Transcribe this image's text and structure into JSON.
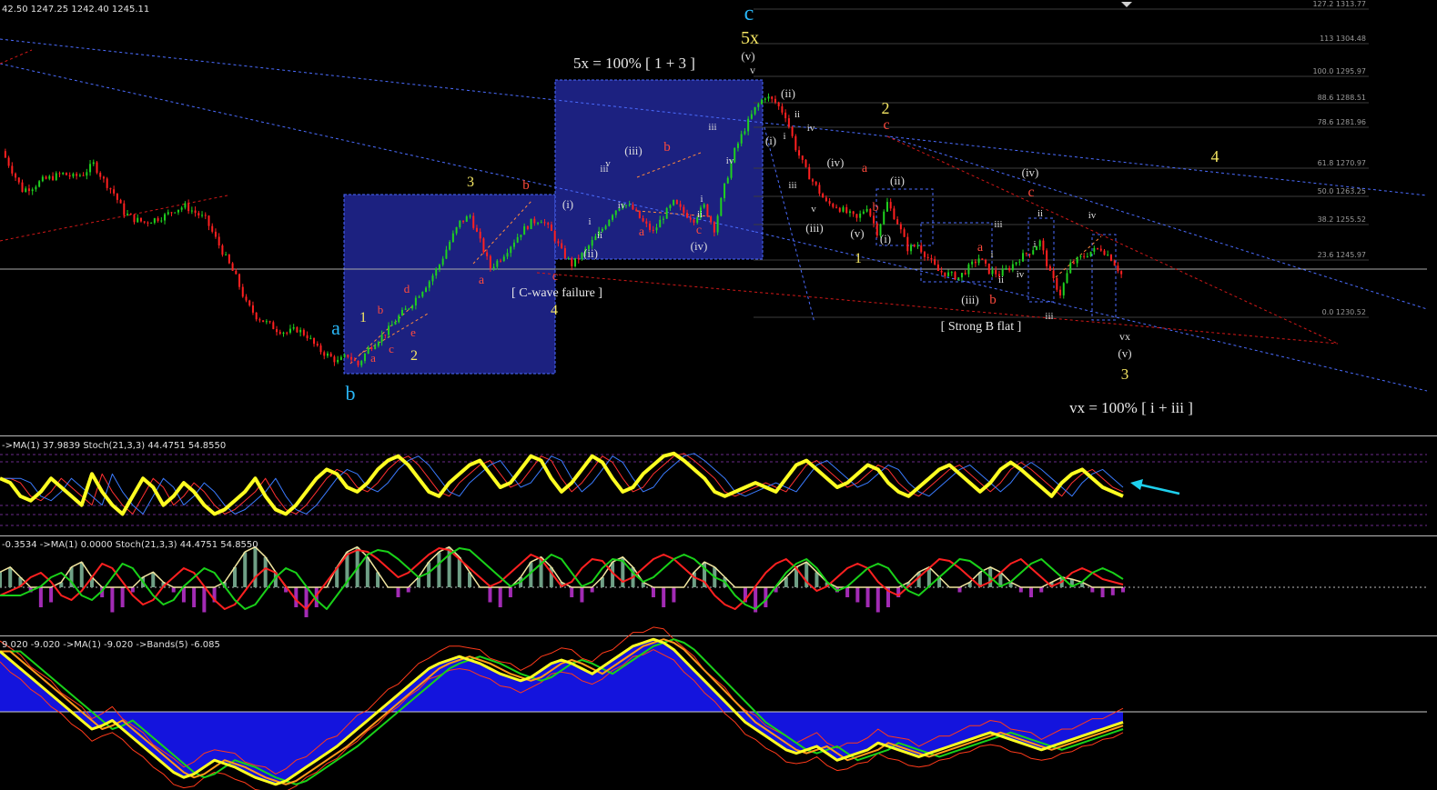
{
  "header": {
    "price_readout": "42.50 1247.25 1242.40 1245.11"
  },
  "panels": {
    "stoch1": {
      "label": "->MA(1) 37.9839  Stoch(21,3,3) 44.4751 54.8550"
    },
    "stoch2": {
      "label": "-0.3534  ->MA(1) 0.0000  Stoch(21,3,3) 44.4751 54.8550"
    },
    "bands": {
      "label": "9.020 -9.020  ->MA(1) -9.020  ->Bands(5) -6.085"
    }
  },
  "annotations": {
    "title_5x": "5x = 100% [ 1 + 3 ]",
    "c_wave_failure": "[ C-wave failure ]",
    "strong_b_flat": "[ Strong B flat ]",
    "vx_ratio": "vx = 100% [ i + iii ]"
  },
  "fib_levels": [
    {
      "label": "127.2 1313.77"
    },
    {
      "label": "113 1304.48"
    },
    {
      "label": "100.0 1295.97"
    },
    {
      "label": "88.6 1288.51"
    },
    {
      "label": "78.6 1281.96"
    },
    {
      "label": "61.8 1270.97"
    },
    {
      "label": "50.0 1263.25"
    },
    {
      "label": "38.2 1255.52"
    },
    {
      "label": "23.6 1245.97"
    },
    {
      "label": "0.0 1230.52"
    }
  ],
  "wave_labels": [
    {
      "text": "c",
      "color": "#29b6f6",
      "size": 24
    },
    {
      "text": "5x",
      "color": "#f5e663",
      "size": 20
    },
    {
      "text": "(v)",
      "color": "#dddddd",
      "size": 13
    },
    {
      "text": "v",
      "color": "#dddddd",
      "size": 12
    },
    {
      "text": "a",
      "color": "#29b6f6",
      "size": 22
    },
    {
      "text": "b",
      "color": "#29b6f6",
      "size": 22
    },
    {
      "text": "1",
      "color": "#f5e663",
      "size": 16
    },
    {
      "text": "2",
      "color": "#f5e663",
      "size": 16
    },
    {
      "text": "b",
      "color": "#ff4a3d",
      "size": 13
    },
    {
      "text": "d",
      "color": "#ff4a3d",
      "size": 13
    },
    {
      "text": "a",
      "color": "#ff4a3d",
      "size": 13
    },
    {
      "text": "c",
      "color": "#ff4a3d",
      "size": 13
    },
    {
      "text": "e",
      "color": "#ff4a3d",
      "size": 13
    },
    {
      "text": "3",
      "color": "#f5e663",
      "size": 16
    },
    {
      "text": "b",
      "color": "#ff4a3d",
      "size": 15
    },
    {
      "text": "a",
      "color": "#ff4a3d",
      "size": 14
    },
    {
      "text": "c",
      "color": "#ff4a3d",
      "size": 14
    },
    {
      "text": "4",
      "color": "#f5e663",
      "size": 16
    },
    {
      "text": "(i)",
      "color": "#dddddd",
      "size": 13
    },
    {
      "text": "(ii)",
      "color": "#dddddd",
      "size": 13
    },
    {
      "text": "ii",
      "color": "#dddddd",
      "size": 11
    },
    {
      "text": "i",
      "color": "#dddddd",
      "size": 11
    },
    {
      "text": "iii",
      "color": "#dddddd",
      "size": 11
    },
    {
      "text": "iv",
      "color": "#dddddd",
      "size": 11
    },
    {
      "text": "(iii)",
      "color": "#dddddd",
      "size": 13
    },
    {
      "text": "v",
      "color": "#dddddd",
      "size": 11
    },
    {
      "text": "b",
      "color": "#ff4a3d",
      "size": 15
    },
    {
      "text": "a",
      "color": "#ff4a3d",
      "size": 14
    },
    {
      "text": "c",
      "color": "#ff4a3d",
      "size": 14
    },
    {
      "text": "(iv)",
      "color": "#dddddd",
      "size": 13
    },
    {
      "text": "ii",
      "color": "#dddddd",
      "size": 11
    },
    {
      "text": "i",
      "color": "#dddddd",
      "size": 11
    },
    {
      "text": "iii",
      "color": "#dddddd",
      "size": 11
    },
    {
      "text": "iv",
      "color": "#dddddd",
      "size": 11
    },
    {
      "text": "(ii)",
      "color": "#dddddd",
      "size": 13
    },
    {
      "text": "ii",
      "color": "#dddddd",
      "size": 11
    },
    {
      "text": "(i)",
      "color": "#dddddd",
      "size": 13
    },
    {
      "text": "i",
      "color": "#dddddd",
      "size": 11
    },
    {
      "text": "iv",
      "color": "#dddddd",
      "size": 11
    },
    {
      "text": "iii",
      "color": "#dddddd",
      "size": 11
    },
    {
      "text": "v",
      "color": "#dddddd",
      "size": 11
    },
    {
      "text": "(iii)",
      "color": "#dddddd",
      "size": 13
    },
    {
      "text": "(iv)",
      "color": "#dddddd",
      "size": 13
    },
    {
      "text": "(v)",
      "color": "#dddddd",
      "size": 13
    },
    {
      "text": "1",
      "color": "#f5e663",
      "size": 16
    },
    {
      "text": "2",
      "color": "#f5e663",
      "size": 18
    },
    {
      "text": "c",
      "color": "#ff4a3d",
      "size": 16
    },
    {
      "text": "a",
      "color": "#ff4a3d",
      "size": 14
    },
    {
      "text": "b",
      "color": "#ff4a3d",
      "size": 14
    },
    {
      "text": "(ii)",
      "color": "#dddddd",
      "size": 13
    },
    {
      "text": "(i)",
      "color": "#dddddd",
      "size": 13
    },
    {
      "text": "(iv)",
      "color": "#dddddd",
      "size": 13
    },
    {
      "text": "c",
      "color": "#ff4a3d",
      "size": 16
    },
    {
      "text": "ii",
      "color": "#dddddd",
      "size": 11
    },
    {
      "text": "i",
      "color": "#dddddd",
      "size": 11
    },
    {
      "text": "iii",
      "color": "#dddddd",
      "size": 11
    },
    {
      "text": "a",
      "color": "#ff4a3d",
      "size": 14
    },
    {
      "text": "i",
      "color": "#dddddd",
      "size": 11
    },
    {
      "text": "ii",
      "color": "#dddddd",
      "size": 11
    },
    {
      "text": "iv",
      "color": "#dddddd",
      "size": 11
    },
    {
      "text": "(iii)",
      "color": "#dddddd",
      "size": 13
    },
    {
      "text": "b",
      "color": "#ff4a3d",
      "size": 15
    },
    {
      "text": "iii",
      "color": "#dddddd",
      "size": 11
    },
    {
      "text": "iv",
      "color": "#dddddd",
      "size": 11
    },
    {
      "text": "vx",
      "color": "#dddddd",
      "size": 12
    },
    {
      "text": "(v)",
      "color": "#dddddd",
      "size": 13
    },
    {
      "text": "3",
      "color": "#f5e663",
      "size": 17
    },
    {
      "text": "4",
      "color": "#f5e663",
      "size": 18
    }
  ],
  "chart_data": {
    "type": "line",
    "ylim": [
      1205,
      1320
    ],
    "price": [
      1279,
      1273,
      1267,
      1268,
      1270,
      1271,
      1272,
      1271,
      1272,
      1275,
      1270,
      1266,
      1260,
      1258,
      1257,
      1258,
      1259,
      1261,
      1262,
      1260,
      1258,
      1252,
      1246,
      1240,
      1232,
      1228,
      1226,
      1224,
      1223,
      1224,
      1222,
      1218,
      1216,
      1214,
      1216,
      1213,
      1218,
      1221,
      1224,
      1228,
      1231,
      1235,
      1239,
      1244,
      1251,
      1257,
      1259,
      1251,
      1243,
      1246,
      1250,
      1254,
      1257,
      1258,
      1254,
      1248,
      1244,
      1247,
      1251,
      1255,
      1260,
      1263,
      1261,
      1257,
      1254,
      1259,
      1263,
      1260,
      1258,
      1262,
      1255,
      1268,
      1279,
      1286,
      1292,
      1296,
      1294,
      1290,
      1280,
      1273,
      1268,
      1263,
      1262,
      1260,
      1258,
      1262,
      1254,
      1263,
      1257,
      1249,
      1250,
      1246,
      1242,
      1241,
      1240,
      1243,
      1246,
      1242,
      1241,
      1243,
      1246,
      1248,
      1251,
      1241,
      1235,
      1244,
      1246,
      1248,
      1249,
      1246,
      1241
    ],
    "stoch1": [
      60,
      55,
      40,
      35,
      45,
      60,
      50,
      40,
      30,
      65,
      45,
      30,
      20,
      40,
      60,
      50,
      30,
      40,
      55,
      45,
      30,
      20,
      25,
      35,
      45,
      60,
      40,
      25,
      20,
      30,
      45,
      60,
      70,
      65,
      50,
      45,
      55,
      70,
      80,
      85,
      75,
      60,
      45,
      40,
      55,
      65,
      75,
      80,
      65,
      50,
      55,
      70,
      85,
      80,
      60,
      45,
      55,
      70,
      85,
      78,
      60,
      45,
      50,
      65,
      75,
      85,
      88,
      80,
      70,
      60,
      45,
      40,
      45,
      50,
      55,
      50,
      45,
      60,
      75,
      80,
      70,
      60,
      50,
      55,
      65,
      75,
      70,
      55,
      45,
      40,
      50,
      60,
      70,
      75,
      65,
      55,
      45,
      55,
      70,
      78,
      70,
      60,
      50,
      40,
      55,
      65,
      70,
      60,
      50,
      45,
      40
    ],
    "stoch2": [
      40,
      45,
      50,
      60,
      65,
      55,
      40,
      35,
      45,
      60,
      75,
      70,
      55,
      40,
      30,
      35,
      50,
      60,
      70,
      65,
      50,
      35,
      25,
      30,
      45,
      60,
      70,
      65,
      50,
      35,
      25,
      40,
      55,
      70,
      85,
      90,
      88,
      80,
      70,
      60,
      65,
      75,
      85,
      92,
      90,
      80,
      70,
      60,
      50,
      55,
      65,
      75,
      85,
      80,
      65,
      50,
      55,
      70,
      80,
      78,
      65,
      55,
      60,
      70,
      80,
      85,
      80,
      70,
      60,
      55,
      40,
      30,
      25,
      35,
      50,
      65,
      75,
      80,
      70,
      55,
      45,
      50,
      60,
      70,
      75,
      70,
      55,
      45,
      40,
      50,
      60,
      70,
      80,
      78,
      70,
      60,
      50,
      55,
      65,
      75,
      80,
      70,
      60,
      50,
      55,
      65,
      70,
      65,
      58,
      55,
      52
    ],
    "hist": [
      15,
      20,
      10,
      -5,
      -20,
      -15,
      5,
      20,
      25,
      10,
      -10,
      -25,
      -20,
      -5,
      10,
      15,
      5,
      -5,
      -15,
      -20,
      -25,
      -15,
      5,
      20,
      35,
      40,
      30,
      15,
      -5,
      -20,
      -30,
      -20,
      0,
      20,
      35,
      40,
      30,
      15,
      0,
      -10,
      -5,
      10,
      25,
      35,
      40,
      30,
      15,
      0,
      -15,
      -20,
      -10,
      10,
      25,
      30,
      20,
      5,
      -10,
      -15,
      -5,
      10,
      25,
      30,
      20,
      5,
      -10,
      -20,
      -15,
      0,
      15,
      25,
      20,
      10,
      0,
      -15,
      -25,
      -20,
      -5,
      10,
      20,
      25,
      15,
      5,
      -5,
      -10,
      -15,
      -20,
      -25,
      -20,
      -10,
      5,
      15,
      20,
      10,
      0,
      -5,
      5,
      15,
      20,
      15,
      5,
      -5,
      -10,
      -5,
      5,
      10,
      8,
      5,
      -5,
      -10,
      -8,
      -5
    ],
    "bands": [
      35,
      30,
      25,
      20,
      15,
      10,
      5,
      0,
      -5,
      -10,
      -8,
      -5,
      -10,
      -15,
      -20,
      -25,
      -30,
      -35,
      -38,
      -36,
      -32,
      -28,
      -30,
      -32,
      -35,
      -38,
      -40,
      -42,
      -40,
      -36,
      -32,
      -28,
      -24,
      -20,
      -15,
      -10,
      -5,
      0,
      5,
      10,
      15,
      20,
      25,
      28,
      30,
      32,
      30,
      28,
      25,
      22,
      20,
      18,
      20,
      24,
      28,
      30,
      28,
      25,
      22,
      26,
      30,
      34,
      38,
      40,
      42,
      40,
      36,
      30,
      24,
      18,
      12,
      6,
      0,
      -6,
      -10,
      -14,
      -18,
      -22,
      -24,
      -22,
      -20,
      -24,
      -28,
      -26,
      -24,
      -22,
      -18,
      -20,
      -22,
      -24,
      -26,
      -24,
      -22,
      -20,
      -18,
      -16,
      -14,
      -12,
      -14,
      -16,
      -18,
      -20,
      -22,
      -20,
      -18,
      -16,
      -14,
      -12,
      -10,
      -8,
      -6
    ]
  },
  "colors": {
    "background": "#000000",
    "bull_candle": "#1fd11f",
    "bear_candle": "#ff2020",
    "box_fill": "#1c2180",
    "box_border": "#4b6cff",
    "stoch_main": "#ffff22",
    "stoch_signal_blue": "#3a7bff",
    "stoch_signal_red": "#ff3030",
    "macd_red": "#ff2020",
    "macd_green": "#19d119",
    "hist_pos": "#6f9f86",
    "hist_neg": "#a22bb4",
    "bands_fill": "#1414dd",
    "arrow": "#1ed0ee",
    "fib_line": "#3c3c3c"
  }
}
